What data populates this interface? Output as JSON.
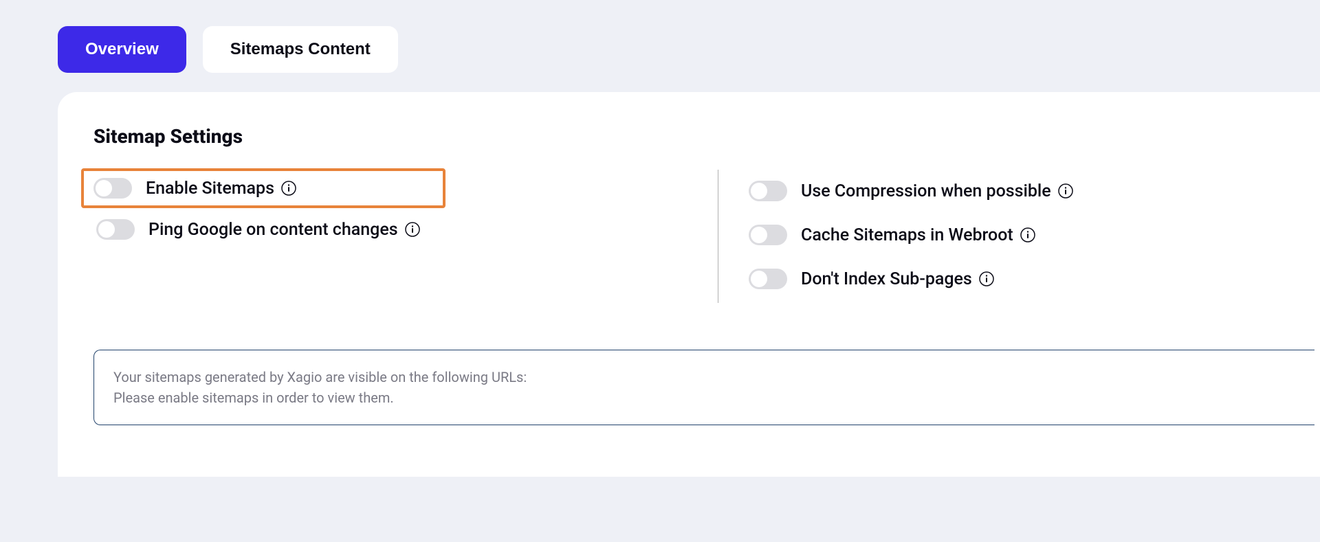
{
  "tabs": {
    "overview": "Overview",
    "sitemaps_content": "Sitemaps Content",
    "active": "overview"
  },
  "section": {
    "title": "Sitemap Settings"
  },
  "toggles": {
    "left": [
      {
        "label": "Enable Sitemaps",
        "on": false,
        "highlight": true
      },
      {
        "label": "Ping Google on content changes",
        "on": false,
        "highlight": false
      }
    ],
    "right": [
      {
        "label": "Use Compression when possible",
        "on": false
      },
      {
        "label": "Cache Sitemaps in Webroot",
        "on": false
      },
      {
        "label": "Don't Index Sub-pages",
        "on": false
      }
    ]
  },
  "notice": {
    "line1": "Your sitemaps generated by Xagio are visible on the following URLs:",
    "line2": "Please enable sitemaps in order to view them."
  },
  "colors": {
    "accent": "#3d29e8",
    "highlight_border": "#e8833a",
    "page_bg": "#eef0f6",
    "card_bg": "#ffffff",
    "notice_border": "#22436c"
  }
}
